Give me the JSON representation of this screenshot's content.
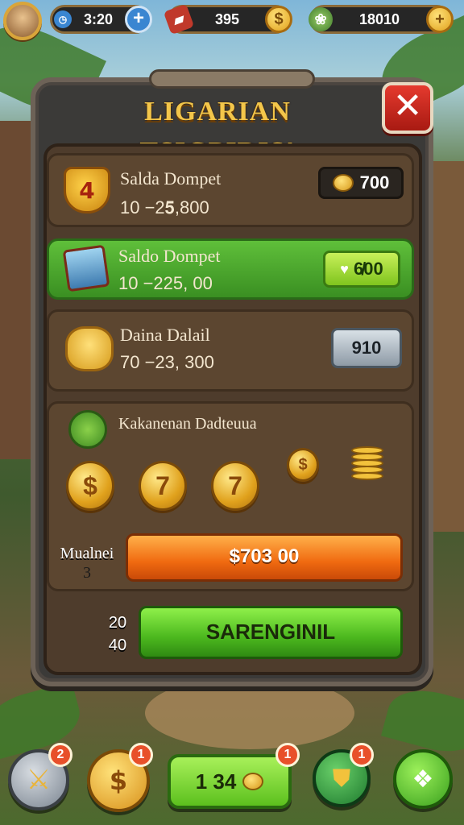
{
  "hud": {
    "time": "3:20",
    "gems": "395",
    "coins": "18010",
    "plus_symbol": "+",
    "coin_symbol": "$"
  },
  "panel": {
    "title": "LIGARIAN TSIGPIDIS!",
    "close_symbol": "✕"
  },
  "rows": [
    {
      "title": "Salda Dompet",
      "value": "10 −2𝟓,800",
      "box": "700",
      "icon_text": "4"
    },
    {
      "title": "Saldo Dompet",
      "value": "10 −225, 00",
      "box": "6̸00"
    },
    {
      "title": "Daina Dalail",
      "value": "70 −23, 300",
      "box": "910"
    }
  ],
  "rewards": {
    "title": "Kakanenan Dadteuua",
    "coins": [
      "$",
      "7",
      "7",
      "$"
    ]
  },
  "purchase": {
    "side_label_1": "Mualnei",
    "side_label_2": "3",
    "price": "$703 00"
  },
  "confirm": {
    "side_label_1": "20",
    "side_label_2": "40",
    "label": "SARENGINIL"
  },
  "bottom_nav": {
    "sword_badge": "2",
    "coin_badge": "1",
    "center_value": "1 34",
    "center_badge": "1",
    "shield_badge": "1",
    "coin_symbol": "$"
  }
}
